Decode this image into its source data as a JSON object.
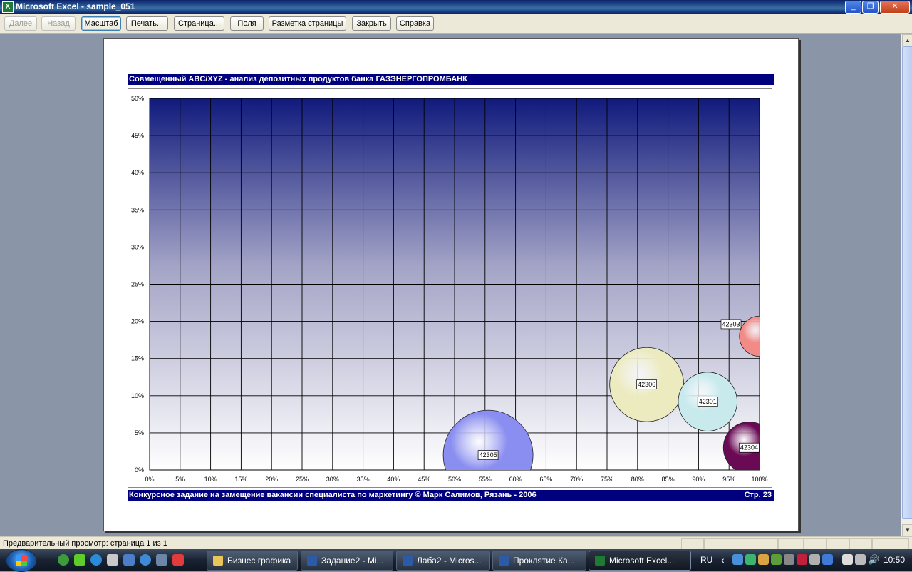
{
  "window": {
    "title": "Microsoft Excel - sample_051"
  },
  "toolbar": {
    "next": "Далее",
    "back": "Назад",
    "zoom": "Масштаб",
    "print": "Печать...",
    "setup": "Страница...",
    "margins": "Поля",
    "page_break": "Разметка страницы",
    "close": "Закрыть",
    "help": "Справка"
  },
  "page": {
    "header": "Совмещенный ABC/XYZ - анализ депозитных продуктов банка ГАЗЭНЕРГОПРОМБАНК",
    "footer": "Конкурсное задание на замещение вакансии специалиста по маркетингу © Марк Салимов, Рязань - 2006",
    "page_number": "Стр. 23"
  },
  "chart_data": {
    "type": "bubble",
    "xlim": [
      0,
      100
    ],
    "ylim": [
      0,
      50
    ],
    "x_ticks": [
      "0%",
      "5%",
      "10%",
      "15%",
      "20%",
      "25%",
      "30%",
      "35%",
      "40%",
      "45%",
      "50%",
      "55%",
      "60%",
      "65%",
      "70%",
      "75%",
      "80%",
      "85%",
      "90%",
      "95%",
      "100%"
    ],
    "y_ticks": [
      "0%",
      "5%",
      "10%",
      "15%",
      "20%",
      "25%",
      "30%",
      "35%",
      "40%",
      "45%",
      "50%"
    ],
    "grid": true,
    "background": {
      "top": "#101a7c",
      "bottom": "#ffffff"
    },
    "points": [
      {
        "label": "42305",
        "x": 55.5,
        "y": 2,
        "size": 1.0,
        "color": "#8a8ef0"
      },
      {
        "label": "42306",
        "x": 81.5,
        "y": 11.5,
        "size": 0.68,
        "color": "#ecebc0"
      },
      {
        "label": "42301",
        "x": 91.5,
        "y": 9.2,
        "size": 0.43,
        "color": "#c8eaed"
      },
      {
        "label": "42304",
        "x": 98.3,
        "y": 3.0,
        "size": 0.33,
        "color": "#6a0a55"
      },
      {
        "label": "42303",
        "x": 100,
        "y": 18,
        "size": 0.2,
        "color": "#f28a85"
      }
    ]
  },
  "status": {
    "text": "Предварительный просмотр: страница 1 из 1"
  },
  "taskbar": {
    "items": [
      "Бизнес графика",
      "Задание2 - Mi...",
      "Лаба2 - Micros...",
      "Проклятие Ка...",
      "Microsoft Excel..."
    ],
    "lang": "RU",
    "clock": "10:50"
  }
}
